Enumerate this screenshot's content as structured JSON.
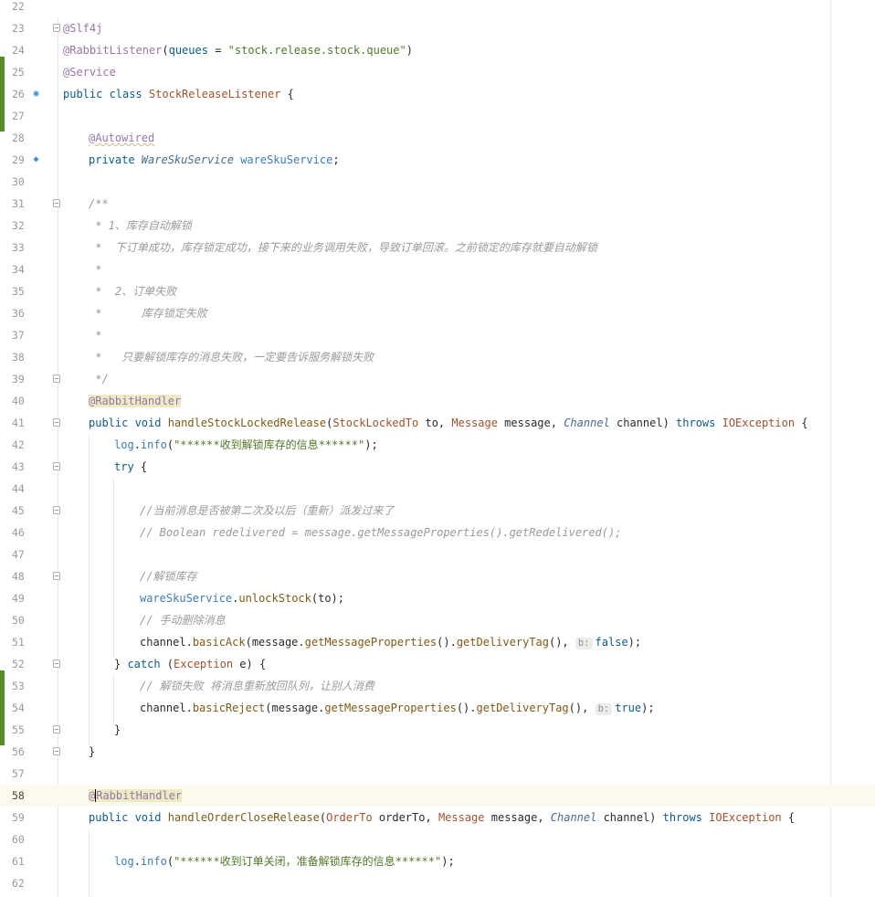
{
  "editor": {
    "line_numbers": [
      "22",
      "23",
      "24",
      "25",
      "26",
      "27",
      "28",
      "29",
      "30",
      "31",
      "32",
      "33",
      "34",
      "35",
      "36",
      "37",
      "38",
      "39",
      "40",
      "41",
      "42",
      "43",
      "44",
      "45",
      "46",
      "47",
      "48",
      "49",
      "50",
      "51",
      "52",
      "53",
      "54",
      "55",
      "56",
      "57",
      "58",
      "59",
      "60",
      "61",
      "62"
    ],
    "current_line": "58",
    "lines": {
      "l23": "@Slf4j",
      "l24_ann": "@RabbitListener",
      "l24_param": "queues",
      "l24_eq": " = ",
      "l24_str": "\"stock.release.stock.queue\"",
      "l25": "@Service",
      "l26_kw": "public class ",
      "l26_name": "StockReleaseListener",
      "l26_rest": " {",
      "l28": "@Autowired",
      "l29_kw": "private ",
      "l29_type": "WareSkuService",
      "l29_field": "wareSkuService",
      "l31": "/**",
      "l32": " * 1、库存自动解锁",
      "l33": " *  下订单成功，库存锁定成功，接下来的业务调用失败，导致订单回滚。之前锁定的库存就要自动解锁",
      "l34": " *",
      "l35": " *  2、订单失败",
      "l36": " *      库存锁定失败",
      "l37": " *",
      "l38": " *   只要解锁库存的消息失败，一定要告诉服务解锁失败",
      "l39": " */",
      "l40": "@RabbitHandler",
      "l41_kw": "public void ",
      "l41_m": "handleStockLockedRelease",
      "l41_t1": "StockLockedTo",
      "l41_p1": " to, ",
      "l41_t2": "Message",
      "l41_p2": " message, ",
      "l41_t3": "Channel",
      "l41_p3": " channel) ",
      "l41_throws": "throws ",
      "l41_ex": "IOException",
      "l41_end": " {",
      "l42_log": "log",
      "l42_info": "info",
      "l42_str": "\"******收到解锁库存的信息******\"",
      "l43": "try",
      "l45": "//当前消息是否被第二次及以后（重新）派发过来了",
      "l46": "// Boolean redelivered = message.getMessageProperties().getRedelivered();",
      "l48": "//解锁库存",
      "l49_f": "wareSkuService",
      "l49_m": "unlockStock",
      "l49_a": "(to);",
      "l50": "// 手动删除消息",
      "l51_c": "channel",
      "l51_m1": "basicAck",
      "l51_a1": "(message.",
      "l51_m2": "getMessageProperties",
      "l51_a2": "().",
      "l51_m3": "getDeliveryTag",
      "l51_a3": "(), ",
      "l51_hint": "b:",
      "l51_val": "false",
      "l51_end": ");",
      "l52_a": "} ",
      "l52_catch": "catch",
      "l52_b": " (",
      "l52_ex": "Exception",
      "l52_c": " e) {",
      "l53": "// 解锁失败 将消息重新放回队列，让别人消费",
      "l54_c": "channel",
      "l54_m1": "basicReject",
      "l54_a1": "(message.",
      "l54_m2": "getMessageProperties",
      "l54_a2": "().",
      "l54_m3": "getDeliveryTag",
      "l54_a3": "(), ",
      "l54_hint": "b:",
      "l54_val": "true",
      "l54_end": ");",
      "l55": "}",
      "l56": "}",
      "l58_at": "@",
      "l58_rest": "RabbitHandler",
      "l59_kw": "public void ",
      "l59_m": "handleOrderCloseRelease",
      "l59_t1": "OrderTo",
      "l59_p1": " orderTo, ",
      "l59_t2": "Message",
      "l59_p2": " message, ",
      "l59_t3": "Channel",
      "l59_p3": " channel) ",
      "l59_throws": "throws ",
      "l59_ex": "IOException",
      "l59_end": " {",
      "l61_log": "log",
      "l61_info": "info",
      "l61_str": "\"******收到订单关闭，准备解锁库存的信息******\""
    }
  }
}
